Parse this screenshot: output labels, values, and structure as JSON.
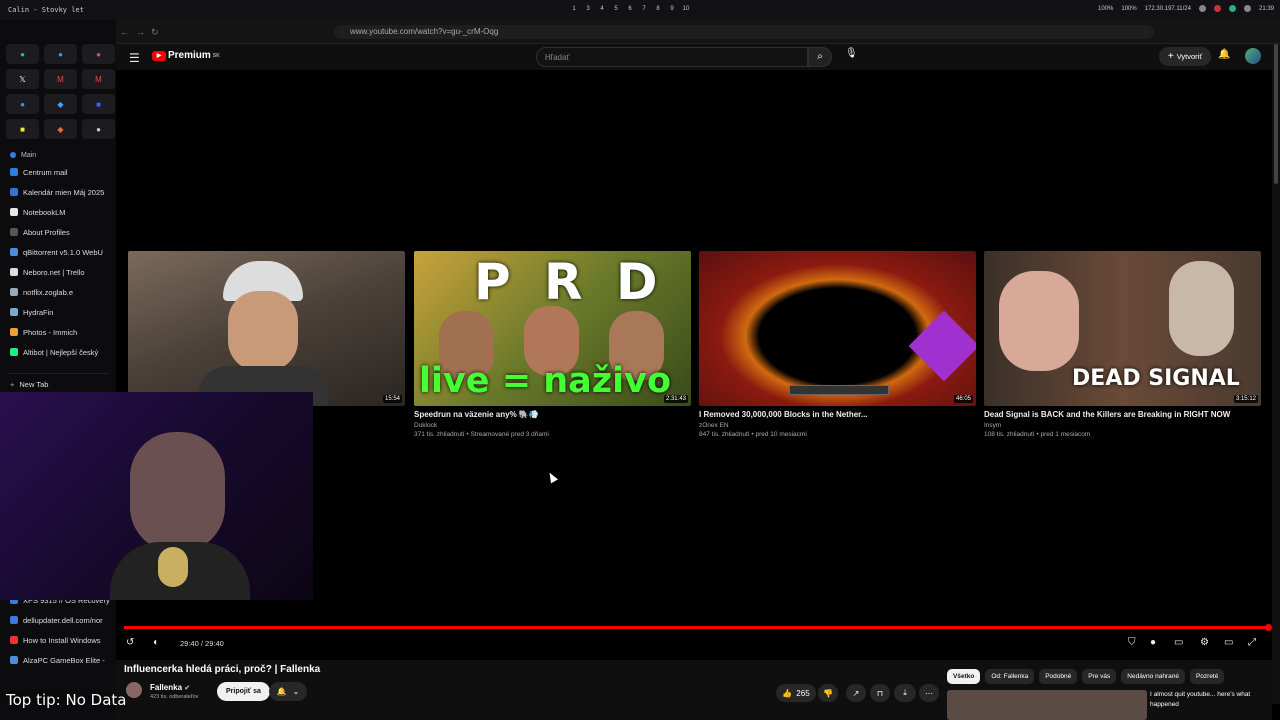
{
  "os": {
    "window_title": "Calin - Stovky let",
    "workspaces": [
      "1",
      "2",
      "3",
      "4",
      "5",
      "6",
      "7",
      "8",
      "9",
      "10"
    ],
    "active_workspace": 1,
    "volume": "100%",
    "brightness": "100%",
    "ip": "172.30.197.11/24",
    "clock": "21:39"
  },
  "browser": {
    "url": "www.youtube.com/watch?v=gu-_crM-Oqg",
    "sidebar_section_main": "Main",
    "sidebar_items": [
      {
        "label": "Centrum mail",
        "color": "#2f7fd8"
      },
      {
        "label": "Kalendár mien Máj 2025",
        "color": "#3a6fd8"
      },
      {
        "label": "NotebookLM",
        "color": "#e8e8e8"
      },
      {
        "label": "About Profiles",
        "color": "#555"
      },
      {
        "label": "qBittorrent v5.1.0 WebU",
        "color": "#4a8fd8"
      },
      {
        "label": "Neboro.net | Trello",
        "color": "#ddd"
      },
      {
        "label": "notflix.zoglab.e",
        "color": "#9ab"
      },
      {
        "label": "HydraFin",
        "color": "#7ac"
      },
      {
        "label": "Photos - Immich",
        "color": "#e9a23b"
      },
      {
        "label": "Altibot | Nejlepší český",
        "color": "#2e8"
      }
    ],
    "new_tab_label": "New Tab",
    "lower_items": [
      {
        "label": "XPS 9315 // OS Recovery",
        "color": "#3a7ad8"
      },
      {
        "label": "dellupdater.dell.com/nor",
        "color": "#3a7ad8"
      },
      {
        "label": "How to Install Windows",
        "color": "#e33"
      },
      {
        "label": "AlzaPC GameBox Elite -",
        "color": "#4a8fd8"
      }
    ]
  },
  "youtube": {
    "logo_text": "Premium",
    "logo_sup": "SK",
    "search_placeholder": "Hľadať",
    "create_label": "Vytvoriť",
    "end_cards": [
      {
        "title": "",
        "channel": "",
        "meta": "",
        "duration": "15:54",
        "thumb": "#5a5048"
      },
      {
        "title": "Speedrun na väzenie any% 🐘💨",
        "channel": "Duklock",
        "meta": "371 tis. zhliadnutí • Streamované pred 3 dňami",
        "duration": "2:31:43",
        "thumb": "#8a6a2a",
        "overlay_top": "P R D",
        "overlay_bottom": "live = naživo"
      },
      {
        "title": "I Removed 30,000,000 Blocks in the Nether...",
        "channel": "zOnex EN",
        "meta": "847 tis. zhliadnutí • pred 10 mesiacmi",
        "duration": "46:05",
        "thumb": "#6a1a1a"
      },
      {
        "title": "Dead Signal is BACK and the Killers are Breaking in RIGHT NOW",
        "channel": "Insym",
        "meta": "108 tis. zhliadnutí • pred 1 mesiacom",
        "duration": "3:15:12",
        "thumb": "#5a4030",
        "overlay": "DEAD SIGNAL"
      }
    ],
    "player": {
      "time": "29:40 / 29:40",
      "progress": 1.0
    },
    "video": {
      "title": "Influencerka hledá práci, proč? | Fallenka",
      "channel": "Fallenka",
      "subscribers": "423 tis. odberateľov",
      "join_label": "Pripojiť sa",
      "likes": "265"
    },
    "chips": [
      "Všetko",
      "Od: Fallenka",
      "Podobné",
      "Pre vás",
      "Nedávno nahrané",
      "Pozreté"
    ],
    "rec_title": "I almost quit youtube... here's what happened"
  },
  "overlay_tip": "Top tip: No Data"
}
